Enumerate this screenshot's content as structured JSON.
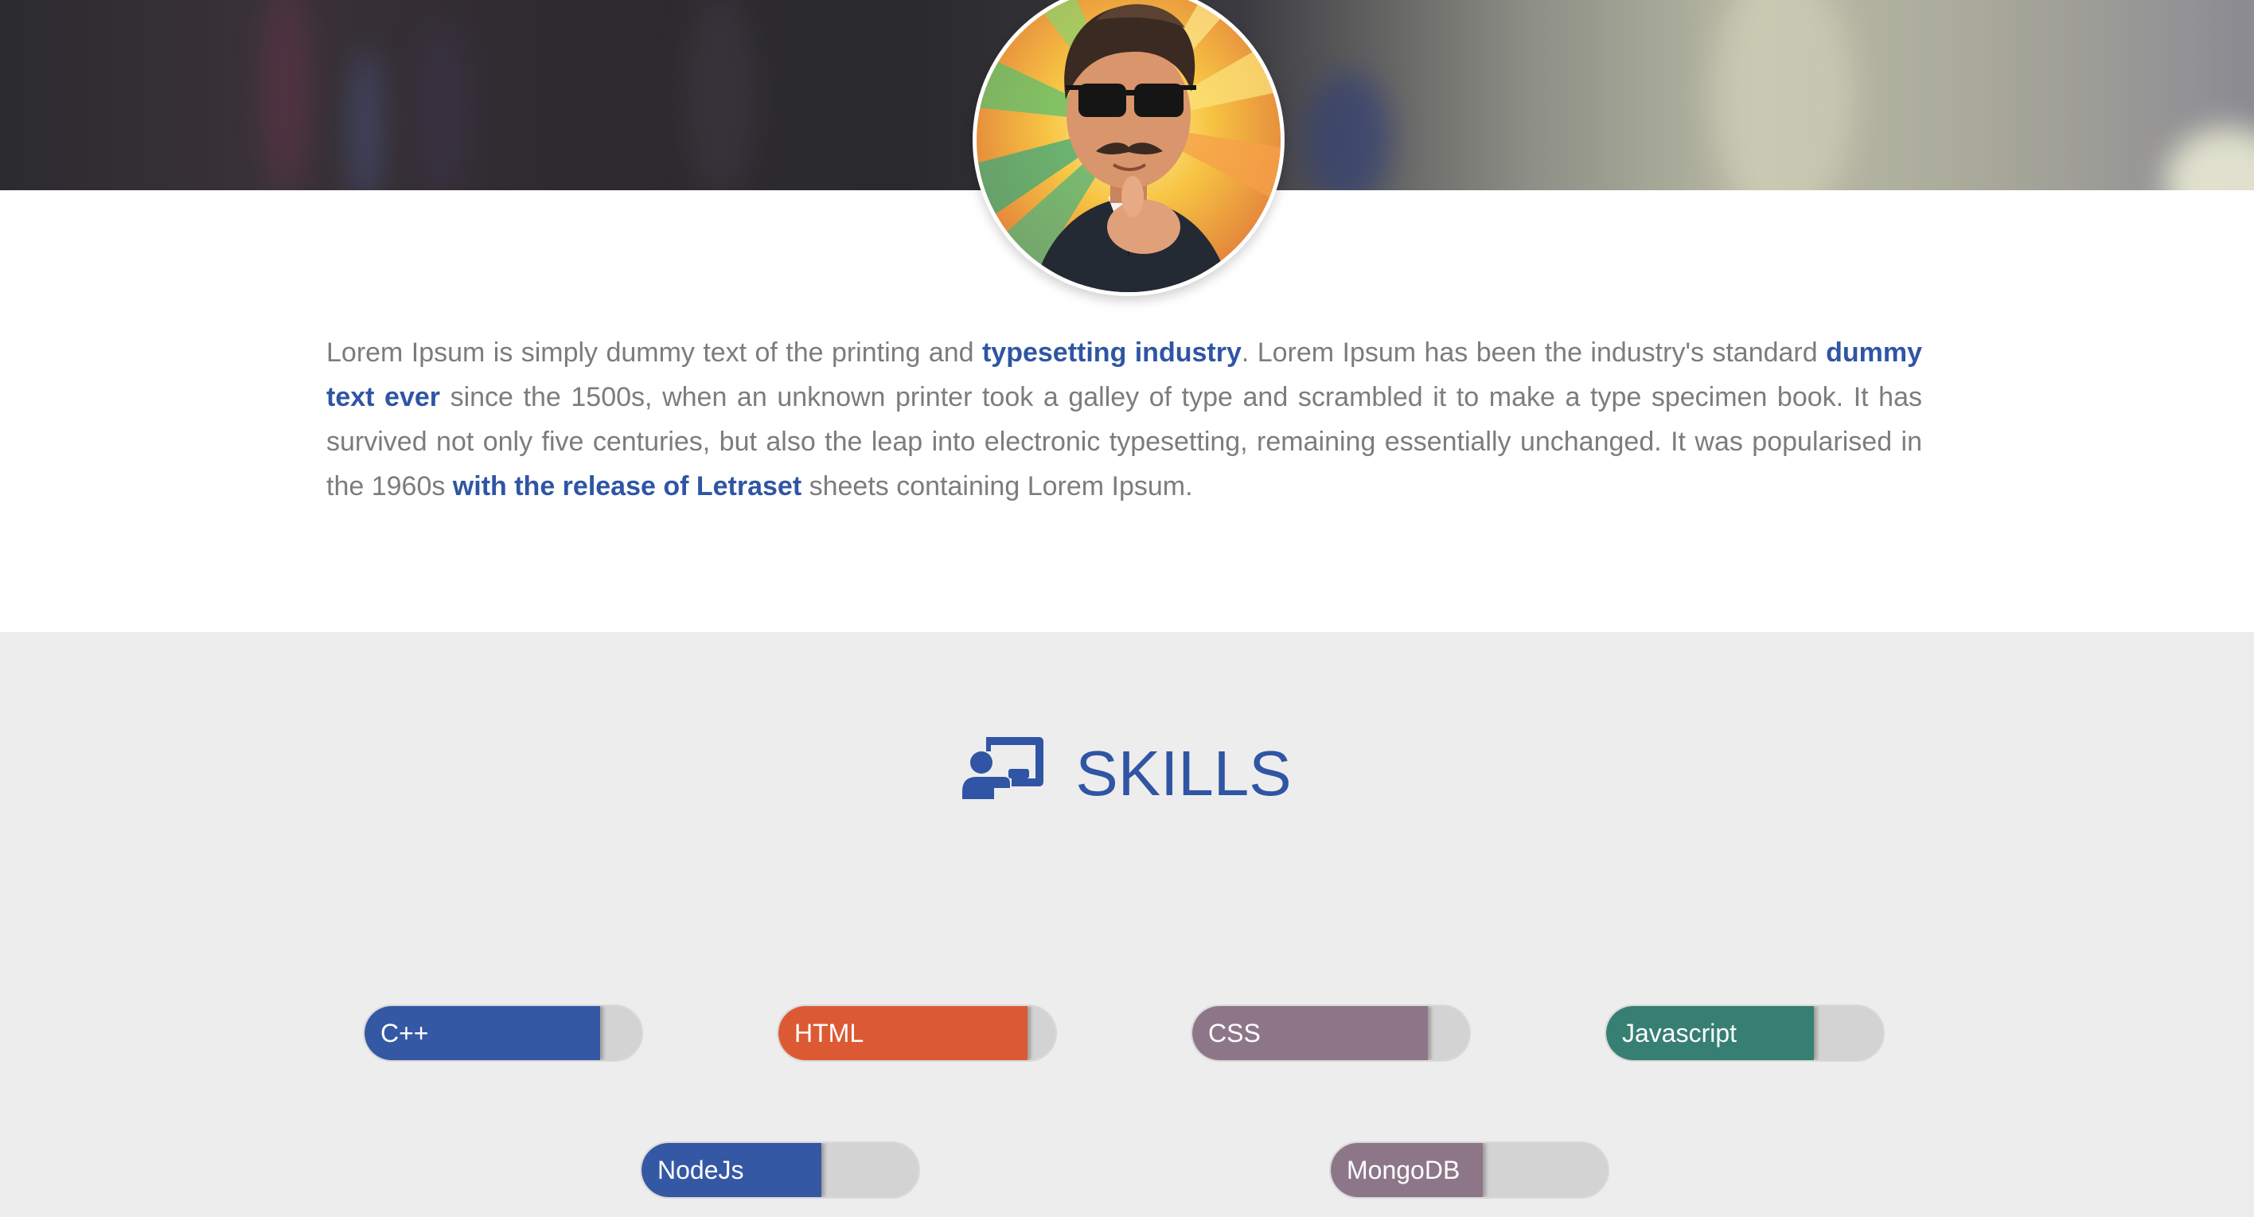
{
  "about": {
    "segments": [
      {
        "text": "Lorem Ipsum is simply dummy text of the printing and ",
        "highlight": false
      },
      {
        "text": "typesetting industry",
        "highlight": true
      },
      {
        "text": ". Lorem Ipsum has been the industry's standard ",
        "highlight": false
      },
      {
        "text": "dummy text ever",
        "highlight": true
      },
      {
        "text": " since the 1500s, when an unknown printer took a galley of type and scrambled it to make a type specimen book. It has survived not only five centuries, but also the leap into electronic typesetting, remaining essentially unchanged. It was popularised in the 1960s ",
        "highlight": false
      },
      {
        "text": "with the release of Letraset",
        "highlight": true
      },
      {
        "text": " sheets containing Lorem Ipsum.",
        "highlight": false
      }
    ]
  },
  "skills": {
    "title": "SKILLS",
    "icon": "chalkboard-teacher-icon",
    "items": [
      {
        "name": "C++",
        "level": 0.85,
        "color": "#3558a4"
      },
      {
        "name": "HTML",
        "level": 0.9,
        "color": "#dc5a33"
      },
      {
        "name": "CSS",
        "level": 0.85,
        "color": "#8e7689"
      },
      {
        "name": "Javascript",
        "level": 0.75,
        "color": "#377f72"
      },
      {
        "name": "NodeJs",
        "level": 0.65,
        "color": "#3558a4"
      },
      {
        "name": "MongoDB",
        "level": 0.55,
        "color": "#8e7689"
      }
    ]
  },
  "colors": {
    "accent": "#2f55a4",
    "section_bg": "#eeeded",
    "body_text": "#7c7c7c"
  }
}
